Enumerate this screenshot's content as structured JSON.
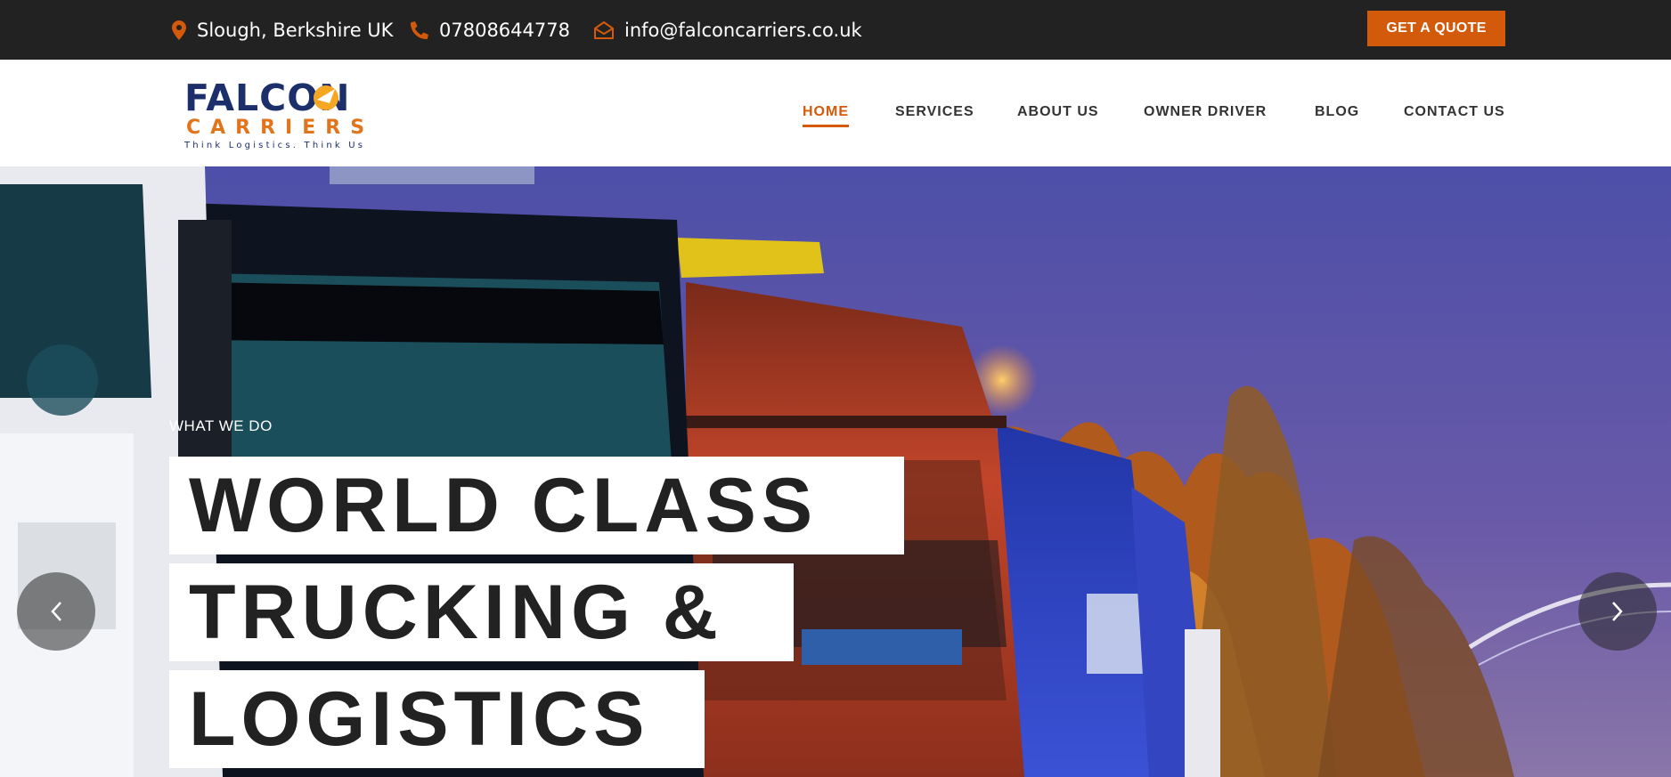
{
  "topbar": {
    "location": "Slough, Berkshire UK",
    "phone": "07808644778",
    "email": "info@falconcarriers.co.uk",
    "quote_label": "GET A QUOTE"
  },
  "logo": {
    "line1": "FALCON",
    "line2": "CARRIERS",
    "tagline": "Think Logistics. Think Us"
  },
  "nav": {
    "items": [
      "HOME",
      "SERVICES",
      "ABOUT US",
      "OWNER DRIVER",
      "BLOG",
      "CONTACT US"
    ],
    "active": "HOME"
  },
  "hero": {
    "kicker": "WHAT WE DO",
    "headline_lines": [
      "WORLD CLASS",
      "TRUCKING &",
      "LOGISTICS"
    ]
  },
  "colors": {
    "accent": "#d35a0b",
    "topbar_bg": "#222222",
    "logo_blue": "#1d2f6b"
  },
  "icons": [
    "map-pin-icon",
    "phone-icon",
    "envelope-icon",
    "chevron-left-icon",
    "chevron-right-icon"
  ]
}
